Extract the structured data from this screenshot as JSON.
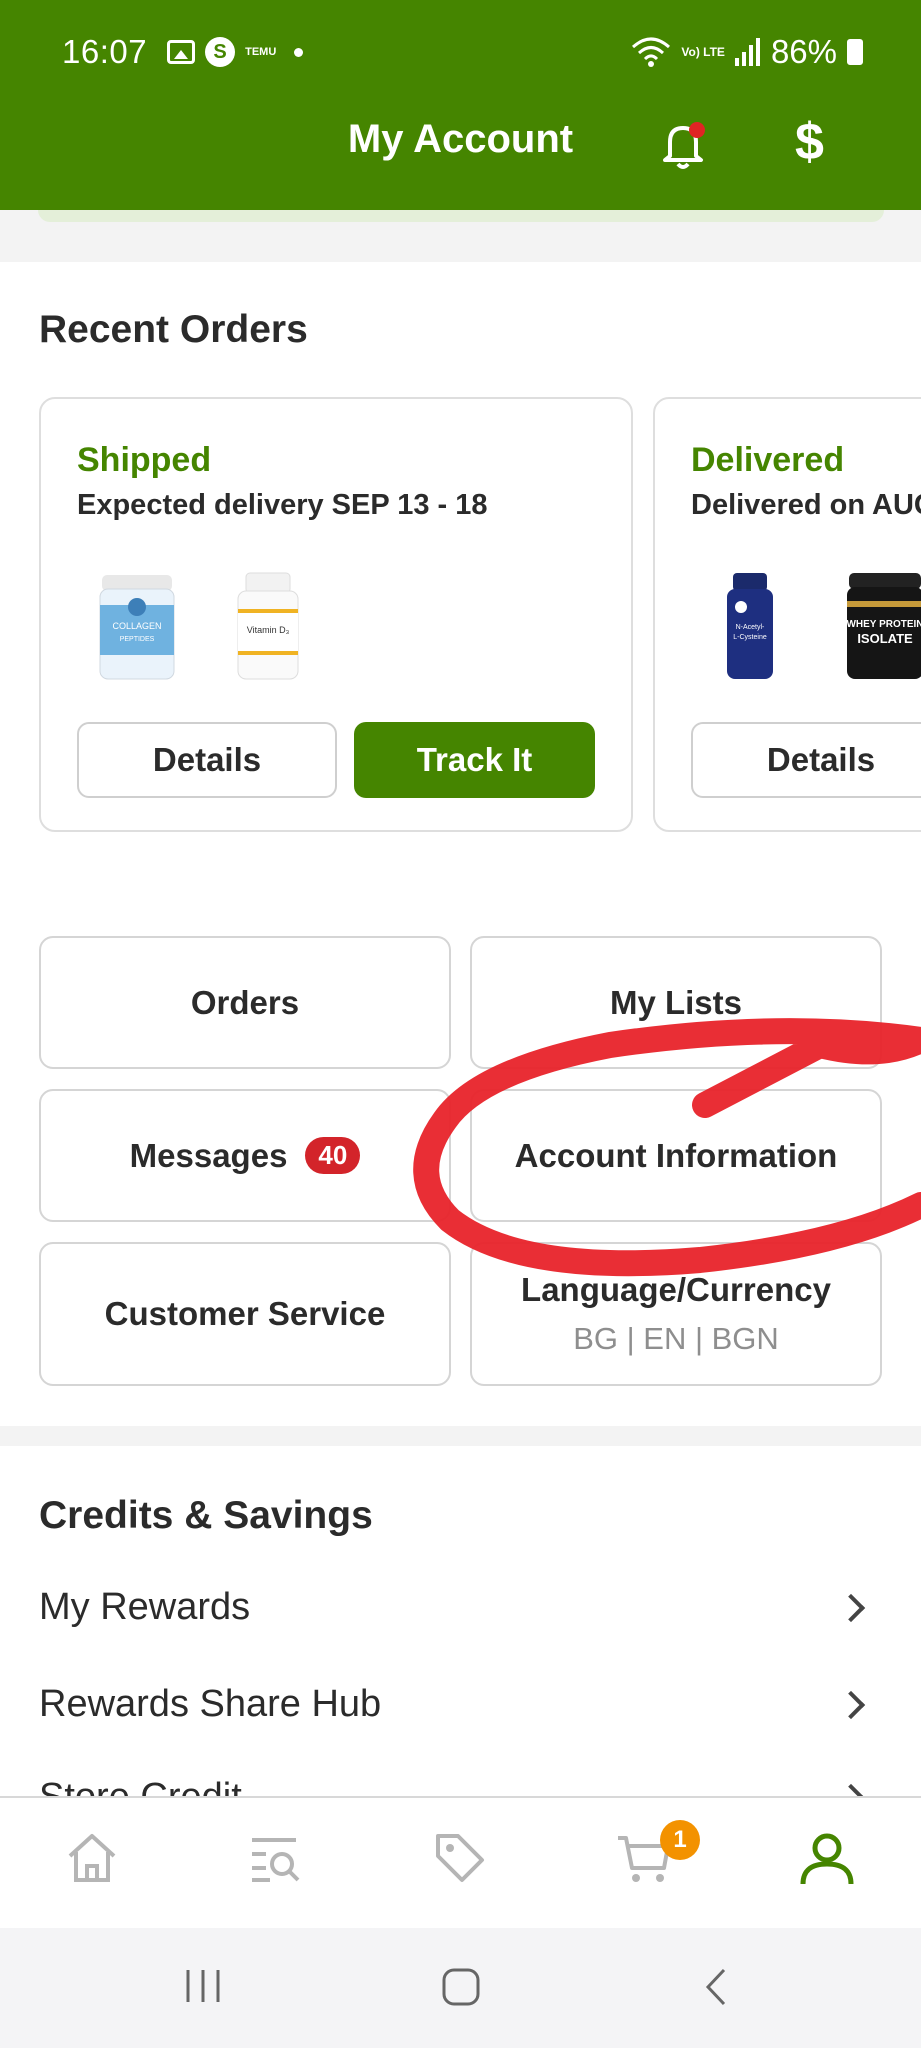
{
  "status_bar": {
    "time": "16:07",
    "temu_label": "TEMU",
    "lte_label": "Vo) LTE",
    "battery": "86%"
  },
  "header": {
    "title": "My Account",
    "currency_symbol": "$"
  },
  "recent_orders": {
    "title": "Recent Orders",
    "orders": [
      {
        "status": "Shipped",
        "delivery": "Expected delivery SEP 13 - 18",
        "products": [
          "COLLAGEN PEPTIDES",
          "Vitamin D3"
        ],
        "details_label": "Details",
        "track_label": "Track It"
      },
      {
        "status": "Delivered",
        "delivery": "Delivered on AUG",
        "products": [
          "N-Acetyl-L-Cysteine",
          "WHEY PROTEIN ISOLATE"
        ],
        "details_label": "Details"
      }
    ]
  },
  "links": {
    "orders": "Orders",
    "my_lists": "My Lists",
    "messages": "Messages",
    "messages_count": "40",
    "account_information": "Account Information",
    "customer_service": "Customer Service",
    "language_currency": "Language/Currency",
    "language_currency_value": "BG | EN | BGN"
  },
  "credits": {
    "title": "Credits & Savings",
    "items": [
      "My Rewards",
      "Rewards Share Hub",
      "Store Credit"
    ]
  },
  "bottom_nav": {
    "cart_count": "1",
    "items": [
      "home-icon",
      "search-list-icon",
      "tag-icon",
      "cart-icon",
      "account-icon"
    ],
    "active": "account-icon"
  },
  "colors": {
    "brand_green": "#458500",
    "badge_red": "#d3242a",
    "cart_badge": "#f39200",
    "annotation_red": "#e8232a"
  }
}
